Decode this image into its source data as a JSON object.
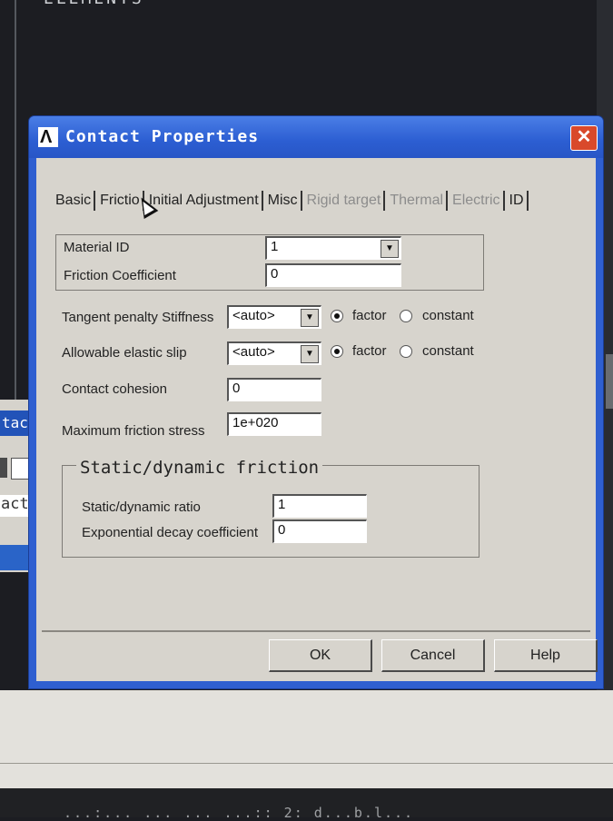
{
  "background": {
    "top_text": "ELEMENTS",
    "left_panel_title": "tac",
    "left_panel_text": "act",
    "bottom_text": "...:... ... ... ...:: 2: d...b.l...",
    "colors": {
      "desktop": "#1c1d22",
      "titlebar": "#2c5ed2",
      "close": "#d9492b",
      "dialog": "#d7d4cd"
    }
  },
  "window": {
    "title": "Contact Properties",
    "close_icon": "close-icon"
  },
  "tabs": [
    {
      "label": "Basic",
      "enabled": true
    },
    {
      "label": "Friction",
      "enabled": true,
      "selected": true
    },
    {
      "label": "Initial Adjustment",
      "enabled": true
    },
    {
      "label": "Misc",
      "enabled": true
    },
    {
      "label": "Rigid target",
      "enabled": false
    },
    {
      "label": "Thermal",
      "enabled": false
    },
    {
      "label": "Electric",
      "enabled": false
    },
    {
      "label": "ID",
      "enabled": true
    }
  ],
  "tab_visible": {
    "friction": "Frictio"
  },
  "material": {
    "material_id_label": "Material ID",
    "material_id_value": "1",
    "friction_coef_label": "Friction Coefficient",
    "friction_coef_value": "0"
  },
  "tangent": {
    "label": "Tangent penalty Stiffness",
    "value": "<auto>",
    "factor_label": "factor",
    "constant_label": "constant",
    "selected": "factor"
  },
  "elastic_slip": {
    "label": "Allowable elastic slip",
    "value": "<auto>",
    "factor_label": "factor",
    "constant_label": "constant",
    "selected": "factor"
  },
  "cohesion": {
    "label": "Contact cohesion",
    "value": "0"
  },
  "max_friction": {
    "label": "Maximum friction stress",
    "value": "1e+020"
  },
  "static_dynamic": {
    "title": "Static/dynamic friction",
    "ratio_label": "Static/dynamic ratio",
    "ratio_value": "1",
    "decay_label": "Exponential decay coefficient",
    "decay_value": "0"
  },
  "buttons": {
    "ok": "OK",
    "cancel": "Cancel",
    "help": "Help"
  }
}
